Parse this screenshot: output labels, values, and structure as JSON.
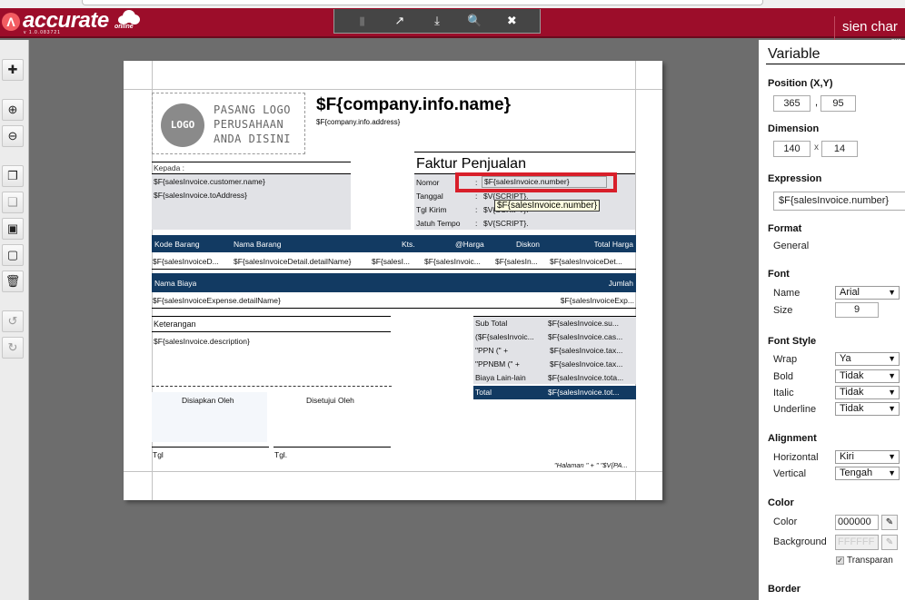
{
  "app": {
    "logo_mark": "Λ",
    "logo_text": "accurate",
    "logo_sub": "online",
    "version": "v 1.0.083721",
    "user_name": "sien char",
    "user_sub": "sus"
  },
  "toolbar": {
    "items": [
      {
        "icon": "save-icon",
        "glyph": "💾",
        "disabled": true
      },
      {
        "icon": "export-icon",
        "glyph": "↗",
        "disabled": false
      },
      {
        "icon": "import-icon",
        "glyph": "⤓",
        "disabled": false
      },
      {
        "icon": "preview-icon",
        "glyph": "🔍",
        "disabled": false
      },
      {
        "icon": "close-icon",
        "glyph": "✖",
        "disabled": false
      }
    ]
  },
  "left_tools": [
    {
      "icon": "add-icon",
      "glyph": "✚"
    },
    {
      "icon": "zoom-in-icon",
      "glyph": "⊕"
    },
    {
      "icon": "zoom-out-icon",
      "glyph": "⊖"
    },
    {
      "icon": "copy-icon",
      "glyph": "❐"
    },
    {
      "icon": "paste-icon",
      "glyph": "❑"
    },
    {
      "icon": "bring-front-icon",
      "glyph": "▣"
    },
    {
      "icon": "send-back-icon",
      "glyph": "▢"
    },
    {
      "icon": "delete-icon",
      "glyph": "🗑"
    },
    {
      "icon": "undo-icon",
      "glyph": "↺"
    },
    {
      "icon": "redo-icon",
      "glyph": "↻"
    }
  ],
  "report": {
    "logo_circle": "LOGO",
    "logo_hint": [
      "PASANG LOGO",
      "PERUSAHAAN",
      "ANDA DISINI"
    ],
    "company_name": "$F{company.info.name}",
    "company_address": "$F{company.info.address}",
    "kepada_label": "Kepada :",
    "customer_name": "$F{salesInvoice.customer.name}",
    "to_address": "$F{salesInvoice.toAddress}",
    "title": "Faktur Penjualan",
    "info": [
      {
        "label": "Nomor",
        "value": "$F{salesInvoice.number}"
      },
      {
        "label": "Tanggal",
        "value": "$V{SCRIPT}."
      },
      {
        "label": "Tgl Kirim",
        "value": "$V{SCRIPT}."
      },
      {
        "label": "Jatuh Tempo",
        "value": "$V{SCRIPT}."
      }
    ],
    "tooltip": "$F{salesInvoice.number}",
    "detail_headers": [
      "Kode Barang",
      "Nama Barang",
      "Kts.",
      "@Harga",
      "Diskon",
      "Total Harga"
    ],
    "detail_row": [
      "$F{salesInvoiceD...",
      "$F{salesInvoiceDetail.detailName}",
      "$F{salesI...",
      "$F{salesInvoic...",
      "$F{salesIn...",
      "$F{salesInvoiceDet..."
    ],
    "expense_headers": [
      "Nama Biaya",
      "Jumlah"
    ],
    "expense_row": [
      "$F{salesInvoiceExpense.detailName}",
      "$F{salesInvoiceExp..."
    ],
    "keterangan_label": "Keterangan",
    "description": "$F{salesInvoice.description}",
    "totals": [
      {
        "label": "Sub Total",
        "value": "$F{salesInvoice.su..."
      },
      {
        "label": "($F{salesInvoic...",
        "value": "$F{salesInvoice.cas..."
      },
      {
        "label": "\"PPN (\" +",
        "value": "$F{salesInvoice.tax..."
      },
      {
        "label": "\"PPNBM (\" +",
        "value": "$F{salesInvoice.tax..."
      },
      {
        "label": "Biaya Lain-lain",
        "value": "$F{salesInvoice.tota..."
      },
      {
        "label": "Total",
        "value": "$F{salesInvoice.tot..."
      }
    ],
    "prepared_by": "Disiapkan Oleh",
    "approved_by": "Disetujui Oleh",
    "tgl1": "Tgl",
    "tgl2": "Tgl.",
    "page_footer": "\"Halaman \" + \" \"$V{PA..."
  },
  "panel": {
    "title": "Variable",
    "position_label": "Position (X,Y)",
    "pos_x": "365",
    "pos_sep": ",",
    "pos_y": "95",
    "dimension_label": "Dimension",
    "dim_w": "140",
    "dim_sep": "x",
    "dim_h": "14",
    "expression_label": "Expression",
    "expression": "$F{salesInvoice.number}",
    "format_label": "Format",
    "format_value": "General",
    "font_label": "Font",
    "font_name_label": "Name",
    "font_name": "Arial",
    "font_size_label": "Size",
    "font_size": "9",
    "font_style_label": "Font Style",
    "wrap_label": "Wrap",
    "wrap": "Ya",
    "bold_label": "Bold",
    "bold": "Tidak",
    "italic_label": "Italic",
    "italic": "Tidak",
    "underline_label": "Underline",
    "underline": "Tidak",
    "alignment_label": "Alignment",
    "horizontal_label": "Horizontal",
    "horizontal": "Kiri",
    "vertical_label": "Vertical",
    "vertical": "Tengah",
    "color_section": "Color",
    "color_label": "Color",
    "color": "000000",
    "background_label": "Background",
    "background": "FFFFFF",
    "transparent_label": "Transparan",
    "transparent": true,
    "border_label": "Border"
  },
  "colors": {
    "brand": "#9c0d2a",
    "navy": "#123a62",
    "selection": "#d81f2a"
  }
}
